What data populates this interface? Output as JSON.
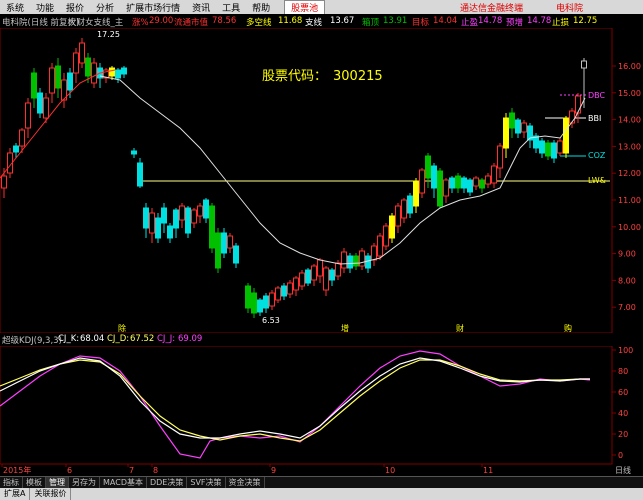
{
  "menubar": {
    "items": [
      "系统",
      "功能",
      "报价",
      "分析",
      "扩展市场行情",
      "资讯",
      "工具",
      "帮助"
    ],
    "active_tab": "股票池",
    "broker": "通达信金融终端",
    "stock_name": "电科院"
  },
  "infobar": {
    "title": "电科院(日线 前复权)",
    "indicator": "大财女支线_主",
    "up_count_label": "涨%",
    "up_count": "29.00",
    "flow_label": "流通市值",
    "flow_value": "78.56",
    "short_label": "多空线",
    "short_value": "11.68",
    "change_label": "支线",
    "change_value": "13.67",
    "box_label": "箱顶",
    "box_value": "13.91",
    "stop_label": "目标",
    "stop_value": "14.04",
    "win_label": "止盈",
    "win_value": "14.78",
    "warn_label": "预增",
    "warn_value": "14.78",
    "loss_label": "止损",
    "loss_value": "12.75"
  },
  "main": {
    "stock_code_label": "股票代码：",
    "stock_code": "300215",
    "high_marker": "17.25",
    "low_marker": "6.53",
    "price_axis": [
      "16.00",
      "15.00",
      "14.00",
      "13.00",
      "12.00",
      "11.00",
      "10.00",
      "9.00",
      "8.00",
      "7.00"
    ],
    "line_labels": {
      "dbc": "DBC",
      "bbi": "BBI",
      "coz": "COZ",
      "lwr": "LW&"
    },
    "event_markers": [
      "除",
      "增",
      "财",
      "购"
    ]
  },
  "kdj": {
    "title": "超级KDJ(9,3,3)",
    "k_label": "CJ_K:",
    "k_value": "68.04",
    "d_label": "CJ_D:",
    "d_value": "67.52",
    "j_label": "CJ_J:",
    "j_value": "69.09",
    "axis": [
      "100",
      "80",
      "60",
      "40",
      "20",
      "0"
    ],
    "date_axis": [
      "2015年",
      "6",
      "7",
      "8",
      "9",
      "10",
      "11"
    ],
    "period_label": "日线"
  },
  "tabs": [
    "指标",
    "模板",
    "管理",
    "另存为",
    "MACD基本",
    "DDE决策",
    "SVF决策",
    "资金决策"
  ],
  "active_tab_index": 2,
  "statusbar": [
    "扩展A",
    "关联报价"
  ],
  "colors": {
    "up": "#ff3030",
    "down": "#00e0e0",
    "green_candle": "#00c000",
    "yellow_candle": "#ffff00",
    "ma": "#ffffff",
    "kdj_k": "#ffffff",
    "kdj_d": "#ffff60",
    "kdj_j": "#ff40ff"
  }
}
